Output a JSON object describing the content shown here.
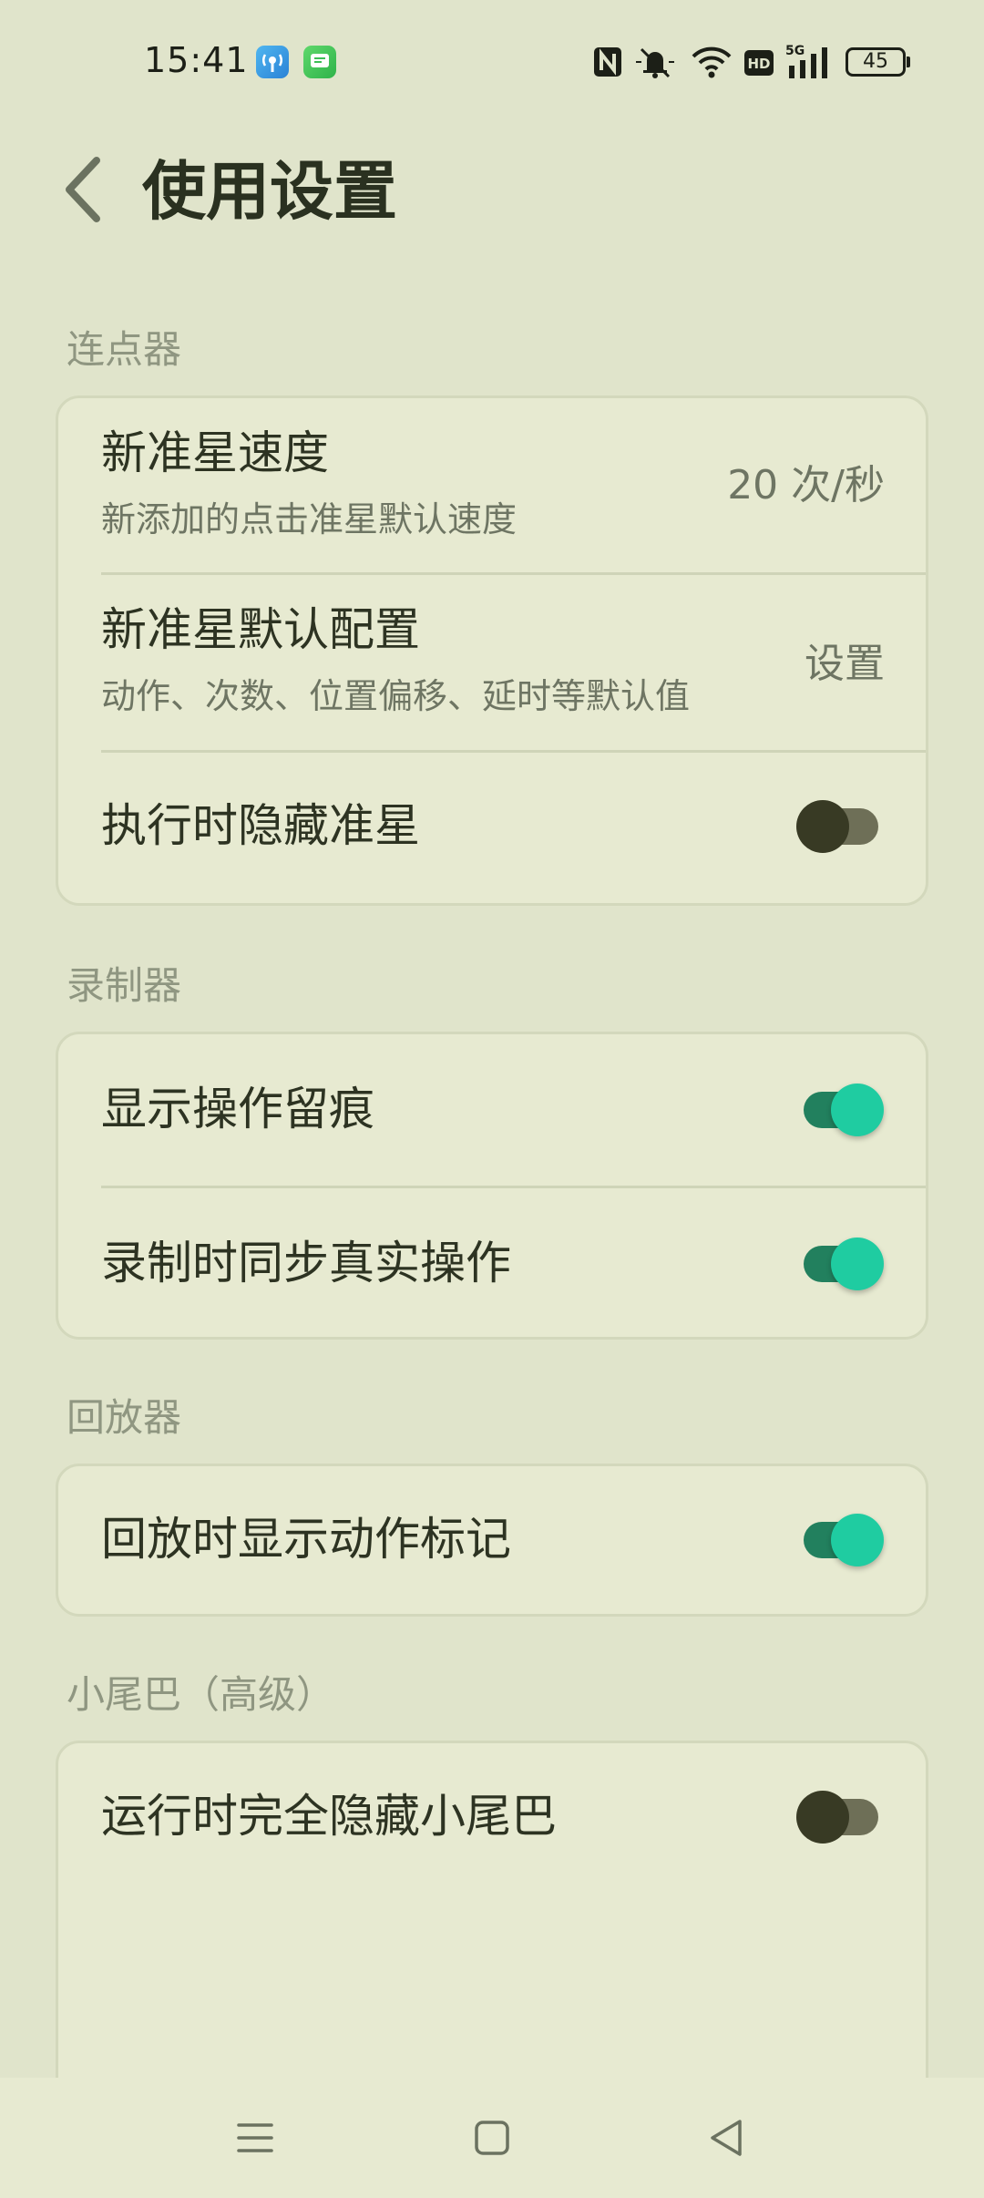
{
  "status_bar": {
    "time": "15:41",
    "battery": "45",
    "network": "5G",
    "icons": [
      "nfc-icon",
      "mute-icon",
      "wifi-icon",
      "hd-icon",
      "signal-icon",
      "battery-icon"
    ]
  },
  "header": {
    "title": "使用设置"
  },
  "sections": {
    "clicker": {
      "title": "连点器",
      "speed_title": "新准星速度",
      "speed_sub": "新添加的点击准星默认速度",
      "speed_value": "20 次/秒",
      "config_title": "新准星默认配置",
      "config_sub": "动作、次数、位置偏移、延时等默认值",
      "config_value": "设置",
      "hide_title": "执行时隐藏准星",
      "hide_on": false
    },
    "recorder": {
      "title": "录制器",
      "trace_title": "显示操作留痕",
      "trace_on": true,
      "sync_title": "录制时同步真实操作",
      "sync_on": true
    },
    "player": {
      "title": "回放器",
      "marker_title": "回放时显示动作标记",
      "marker_on": true
    },
    "tail": {
      "title": "小尾巴（高级）",
      "hide_tail_title": "运行时完全隐藏小尾巴",
      "hide_tail_on": false
    }
  },
  "colors": {
    "background": "#e0e4cb",
    "card": "#e7ead1",
    "switch_on_knob": "#1fcca1",
    "switch_on_track": "#22805e",
    "switch_off_knob": "#383a24"
  }
}
